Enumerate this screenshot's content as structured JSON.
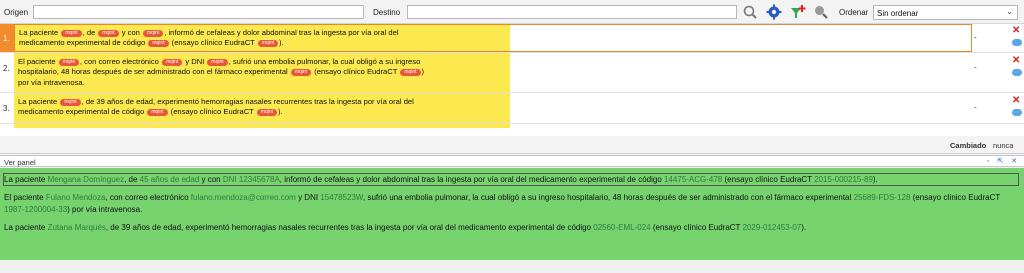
{
  "toolbar": {
    "origen_label": "Origen",
    "destino_label": "Destino",
    "ordenar_label": "Ordenar",
    "ordenar_value": "Sin ordenar"
  },
  "tag_label": "mqint",
  "rows": [
    {
      "num": "1.",
      "lines": [
        [
          "La paciente ",
          "TAG",
          ", de ",
          "TAG",
          " y con ",
          "TAG",
          ", informó de cefaleas y dolor abdominal tras la ingesta por vía oral del"
        ],
        [
          "medicamento experimental de código ",
          "TAG",
          " (ensayo clínico EudraCT ",
          "TAG",
          ")."
        ]
      ],
      "status": "-"
    },
    {
      "num": "2.",
      "lines": [
        [
          "El paciente ",
          "TAG",
          ", con correo electrónico ",
          "TAG",
          " y DNI ",
          "TAG",
          ", sufrió una embolia pulmonar, la cual obligó a su ingreso"
        ],
        [
          "hospitalario, 48 horas después de ser administrado con el fármaco experimental ",
          "TAG",
          " (ensayo clínico EudraCT ",
          "TAG",
          ")"
        ],
        [
          "por vía intravenosa."
        ]
      ],
      "status": "-"
    },
    {
      "num": "3.",
      "lines": [
        [
          "La paciente ",
          "TAG",
          ", de 39 años de edad, experimentó hemorragias nasales recurrentes tras la ingesta por vía oral del"
        ],
        [
          "medicamento experimental de código ",
          "TAG",
          " (ensayo clínico EudraCT ",
          "TAG",
          ")."
        ]
      ],
      "status": "-"
    }
  ],
  "status_bar": {
    "label": "Cambiado",
    "value": "nunca"
  },
  "panel": {
    "title": "Ver panel"
  },
  "preview": [
    [
      {
        "t": "La paciente "
      },
      {
        "e": "Mengana Domínguez"
      },
      {
        "t": ", de "
      },
      {
        "e": "45 años de edad"
      },
      {
        "t": " y con "
      },
      {
        "e": "DNI 12345678A"
      },
      {
        "t": ", informó de cefaleas y dolor abdominal tras la ingesta por vía oral del medicamento experimental de código "
      },
      {
        "e": "14475-ACG-478"
      },
      {
        "t": " (ensayo clínico EudraCT "
      },
      {
        "e": "2015-000215-89"
      },
      {
        "t": ")."
      }
    ],
    [
      {
        "t": "El paciente "
      },
      {
        "e": "Fulano Mendoza"
      },
      {
        "t": ", con correo electrónico "
      },
      {
        "e": "fulano.mendoza@correo.com"
      },
      {
        "t": " y DNI "
      },
      {
        "e": "15478523W"
      },
      {
        "t": ", sufrió una embolia pulmonar, la cual obligó a su ingreso hospitalario, 48 horas después de ser administrado con el fármaco experimental "
      },
      {
        "e": "25689-FDS-128"
      },
      {
        "t": " (ensayo clínico EudraCT "
      },
      {
        "e": "1987-1200004-33"
      },
      {
        "t": ") por vía intravenosa."
      }
    ],
    [
      {
        "t": "La paciente "
      },
      {
        "e": "Zutana Marqués"
      },
      {
        "t": ", de 39 años de edad, experimentó hemorragias nasales recurrentes tras la ingesta por vía oral del medicamento experimental de código "
      },
      {
        "e": "02560-EML-024"
      },
      {
        "t": " (ensayo clínico EudraCT "
      },
      {
        "e": "2029-012453-07"
      },
      {
        "t": ")."
      }
    ]
  ],
  "colors": {
    "tag": "#e8573a",
    "highlight": "#fce94f",
    "preview_bg": "#76d36e",
    "entity": "#2e7d3a",
    "active_row": "#f28b2b"
  },
  "icons": [
    "search-magnifier-icon",
    "gear-icon",
    "add-filter-icon",
    "zoom-icon",
    "delete-icon",
    "comment-icon"
  ]
}
